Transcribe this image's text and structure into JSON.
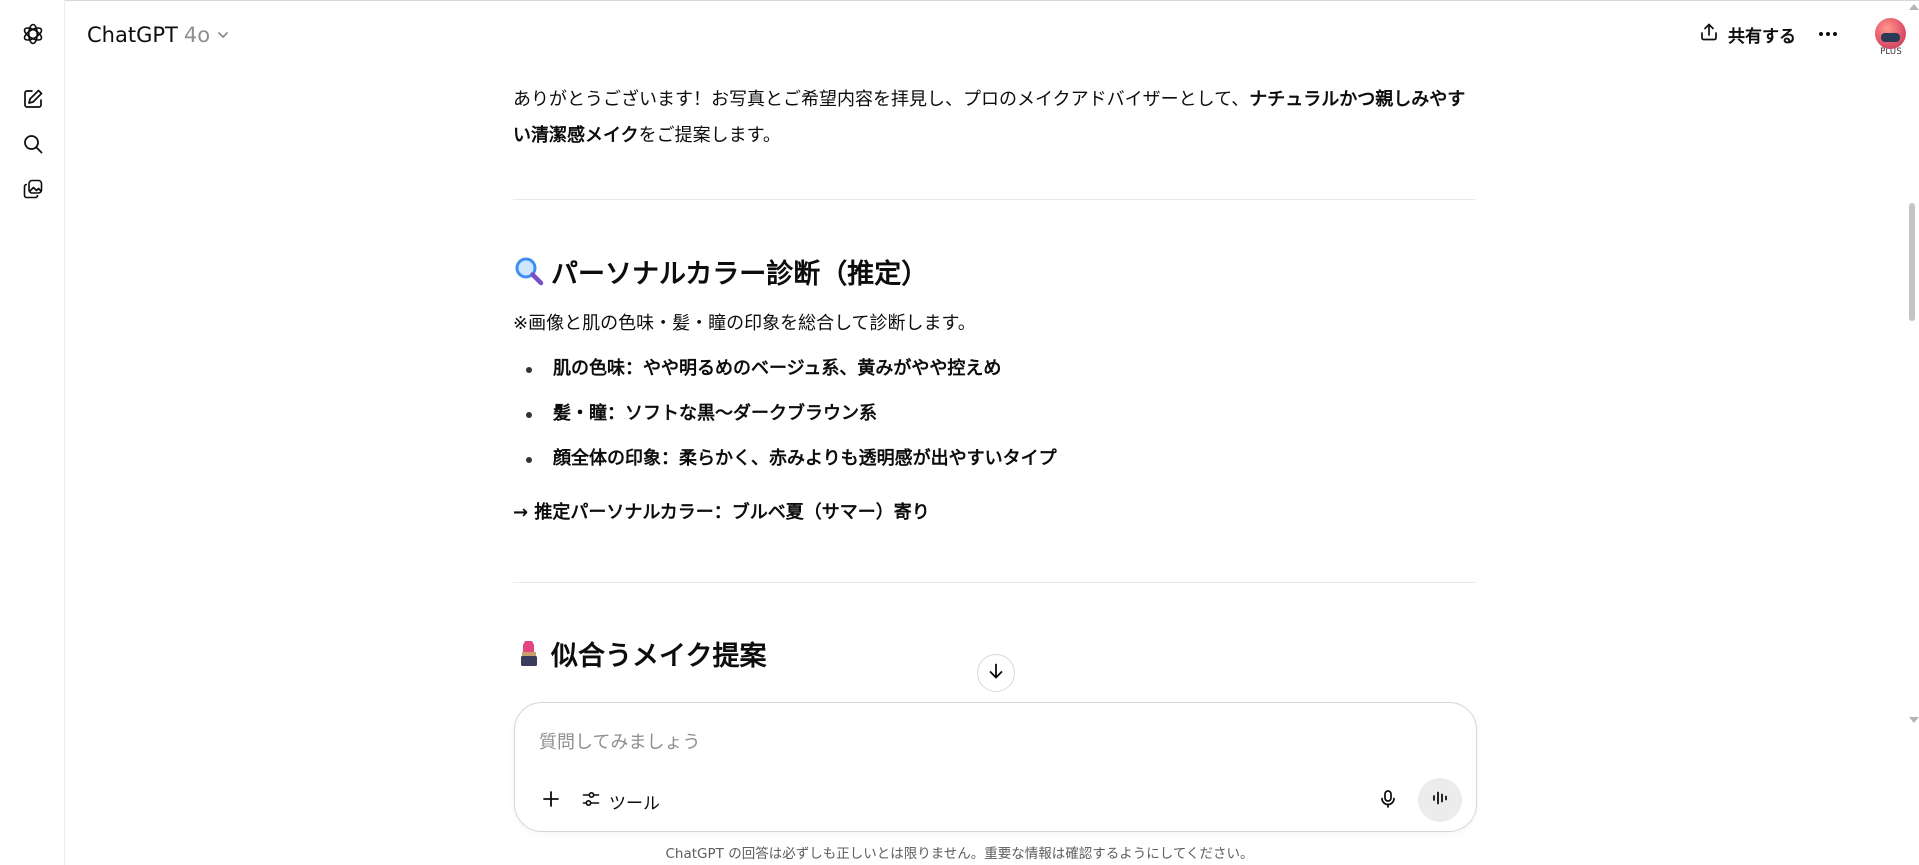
{
  "header": {
    "model_name": "ChatGPT",
    "model_version": "4o",
    "share_label": "共有する",
    "plan_badge": "PLUS"
  },
  "sidebar": {
    "icons": [
      "chatgpt-logo-icon",
      "new-chat-icon",
      "search-icon",
      "library-icon"
    ]
  },
  "message": {
    "intro_plain": "ありがとうございます！お写真とご希望内容を拝見し、プロのメイクアドバイザーとして、",
    "intro_bold": "ナチュラルかつ親しみやすい清潔感メイク",
    "intro_tail": "をご提案します。",
    "section1": {
      "emoji": "🔍",
      "title": "パーソナルカラー診断（推定）",
      "note": "※画像と肌の色味・髪・瞳の印象を総合して診断します。",
      "bullets": [
        "肌の色味：やや明るめのベージュ系、黄みがやや控えめ",
        "髪・瞳：ソフトな黒〜ダークブラウン系",
        "顔全体の印象：柔らかく、赤みよりも透明感が出やすいタイプ"
      ],
      "conclusion": "→ 推定パーソナルカラー：ブルベ夏（サマー）寄り"
    },
    "section2": {
      "emoji": "💄",
      "title": "似合うメイク提案"
    }
  },
  "composer": {
    "placeholder": "質問してみましょう",
    "tools_label": "ツール"
  },
  "footer": {
    "disclaimer": "ChatGPT の回答は必ずしも正しいとは限りません。重要な情報は確認するようにしてください。"
  },
  "colors": {
    "text": "#0d0d0d",
    "muted": "#8f8f8f",
    "border": "#d6d6d6",
    "voice_button_bg": "#ececec"
  }
}
